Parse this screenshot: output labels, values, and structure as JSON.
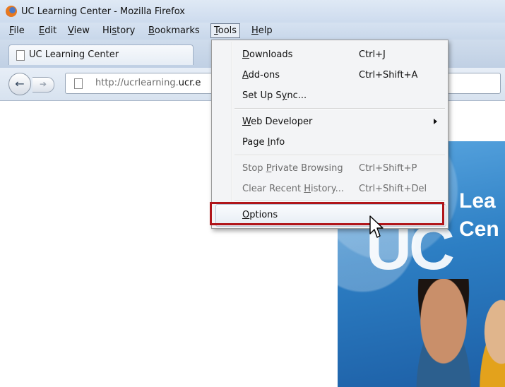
{
  "window": {
    "title": "UC Learning Center - Mozilla Firefox"
  },
  "menubar": {
    "items": [
      {
        "label_pre": "",
        "mnemonic": "F",
        "label_post": "ile"
      },
      {
        "label_pre": "",
        "mnemonic": "E",
        "label_post": "dit"
      },
      {
        "label_pre": "",
        "mnemonic": "V",
        "label_post": "iew"
      },
      {
        "label_pre": "Hi",
        "mnemonic": "s",
        "label_post": "tory"
      },
      {
        "label_pre": "",
        "mnemonic": "B",
        "label_post": "ookmarks"
      },
      {
        "label_pre": "",
        "mnemonic": "T",
        "label_post": "ools"
      },
      {
        "label_pre": "",
        "mnemonic": "H",
        "label_post": "elp"
      }
    ]
  },
  "tab": {
    "label": "UC Learning Center"
  },
  "navbar": {
    "back_icon": "←",
    "forward_icon": "➔",
    "url_prefix": "http://ucrlearning.",
    "url_domain": "ucr.e"
  },
  "tools_menu": {
    "items": [
      {
        "pre": "",
        "mn": "D",
        "post": "ownloads",
        "shortcut": "Ctrl+J",
        "disabled": false
      },
      {
        "pre": "",
        "mn": "A",
        "post": "dd-ons",
        "shortcut": "Ctrl+Shift+A",
        "disabled": false
      },
      {
        "pre": "Set Up S",
        "mn": "y",
        "post": "nc...",
        "shortcut": "",
        "disabled": false
      },
      {
        "pre": "",
        "mn": "W",
        "post": "eb Developer",
        "shortcut": "",
        "disabled": false
      },
      {
        "pre": "Page ",
        "mn": "I",
        "post": "nfo",
        "shortcut": "",
        "disabled": false
      },
      {
        "pre": "Stop ",
        "mn": "P",
        "post": "rivate Browsing",
        "shortcut": "Ctrl+Shift+P",
        "disabled": true
      },
      {
        "pre": "Clear Recent ",
        "mn": "H",
        "post": "istory...",
        "shortcut": "Ctrl+Shift+Del",
        "disabled": true
      },
      {
        "pre": "",
        "mn": "O",
        "post": "ptions",
        "shortcut": "",
        "disabled": false
      }
    ]
  },
  "banner": {
    "logo": "UC",
    "line1": "Lea",
    "line2": "Cen"
  },
  "colors": {
    "highlight": "#b0151a",
    "banner_blue": "#2d7fc4"
  }
}
